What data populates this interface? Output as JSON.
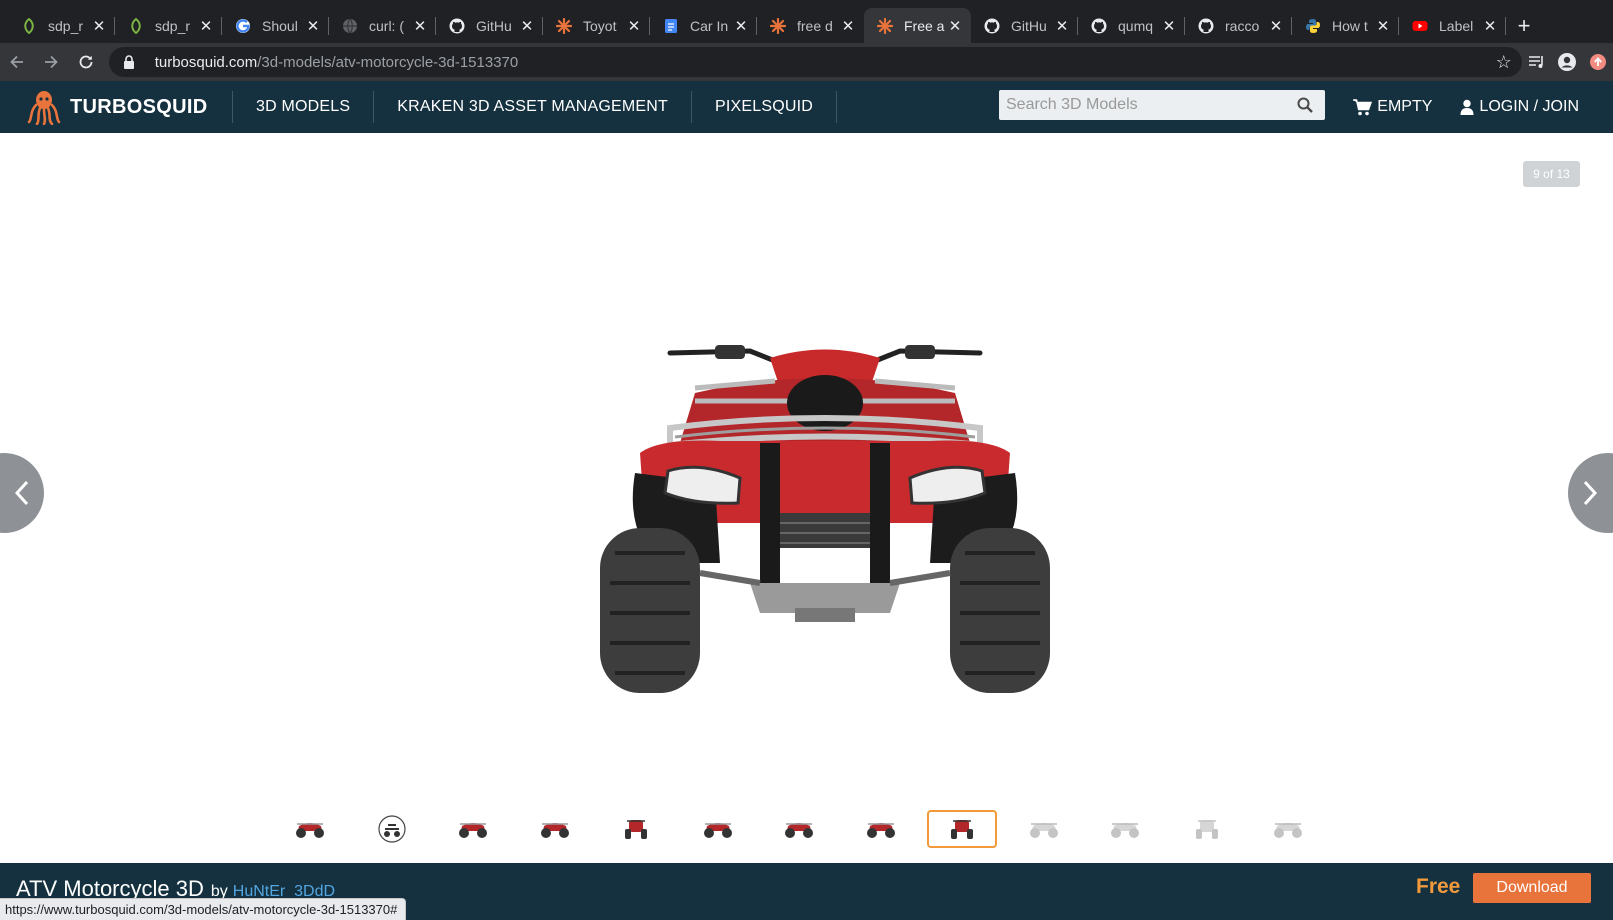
{
  "browser": {
    "tabs": [
      {
        "title": "sdp_r",
        "icon": "sdp-leaf-icon"
      },
      {
        "title": "sdp_r",
        "icon": "sdp-leaf-icon"
      },
      {
        "title": "Shoul",
        "icon": "google-icon"
      },
      {
        "title": "curl: (",
        "icon": "globe-icon"
      },
      {
        "title": "GitHu",
        "icon": "github-icon"
      },
      {
        "title": "Toyot",
        "icon": "turbosquid-icon"
      },
      {
        "title": "Car In",
        "icon": "google-docs-icon"
      },
      {
        "title": "free d",
        "icon": "turbosquid-icon"
      },
      {
        "title": "Free a",
        "icon": "turbosquid-icon",
        "active": true
      },
      {
        "title": "GitHu",
        "icon": "github-icon"
      },
      {
        "title": "qumq",
        "icon": "github-icon"
      },
      {
        "title": "racco",
        "icon": "github-icon"
      },
      {
        "title": "How t",
        "icon": "python-icon"
      },
      {
        "title": "Label",
        "icon": "youtube-icon"
      }
    ],
    "url_host": "turbosquid.com",
    "url_path": "/3d-models/atv-motorcycle-3d-1513370",
    "status_url": "https://www.turbosquid.com/3d-models/atv-motorcycle-3d-1513370#"
  },
  "site": {
    "logo_text": "TURBOSQUID",
    "nav": [
      "3D MODELS",
      "KRAKEN 3D ASSET MANAGEMENT",
      "PIXELSQUID"
    ],
    "search_placeholder": "Search 3D Models",
    "cart_label": "EMPTY",
    "login_label": "LOGIN / JOIN"
  },
  "viewer": {
    "counter": "9 of 13",
    "thumbnail_count": 13,
    "selected_index": 8
  },
  "product": {
    "title": "ATV Motorcycle 3D",
    "by": "by",
    "author": "HuNtEr_3DdD",
    "price": "Free",
    "download_label": "Download"
  },
  "colors": {
    "header_bg": "#15313f",
    "accent_orange": "#e8733b",
    "price_orange": "#f29a3b",
    "author_link": "#53a5e0"
  }
}
